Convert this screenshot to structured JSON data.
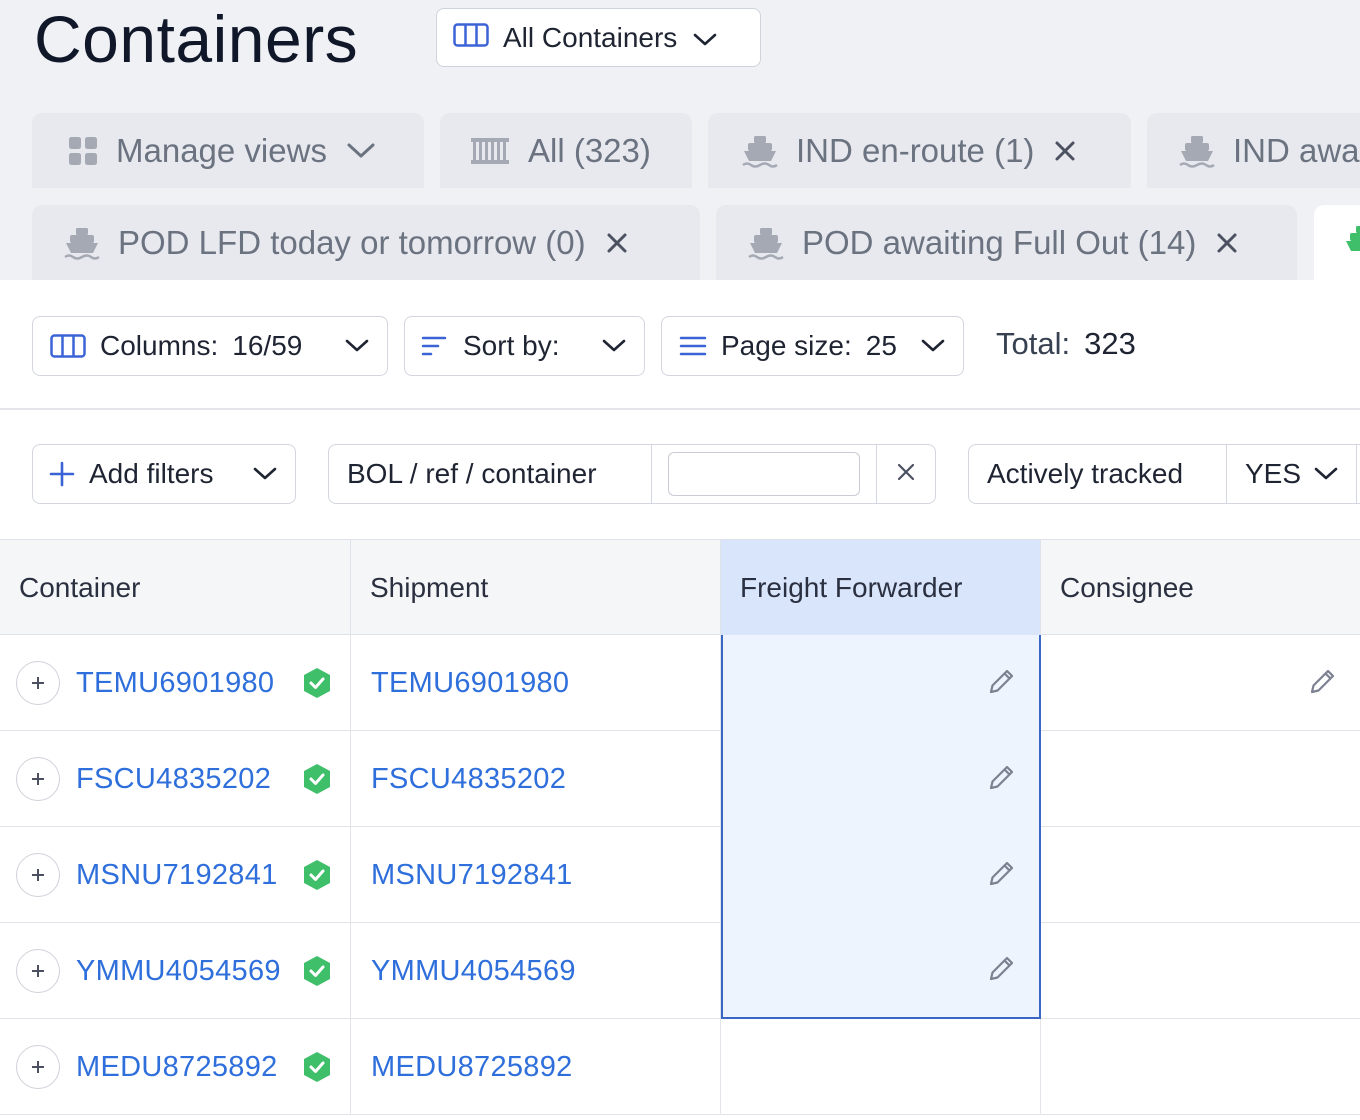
{
  "header": {
    "title": "Containers",
    "view_select": {
      "label": "All Containers",
      "icon": "columns-icon"
    }
  },
  "tabs": [
    {
      "label": "Manage views",
      "icon": "grid-icon",
      "closable": false,
      "dropdown": true
    },
    {
      "label": "All (323)",
      "icon": "container-icon",
      "closable": false
    },
    {
      "label": "IND en-route (1)",
      "icon": "ship-icon",
      "closable": true
    },
    {
      "label": "IND awa",
      "icon": "ship-icon",
      "closable": false
    },
    {
      "label": "POD LFD today or tomorrow (0)",
      "icon": "ship-icon",
      "closable": true
    },
    {
      "label": "POD awaiting Full Out (14)",
      "icon": "ship-icon",
      "closable": true
    },
    {
      "label": "",
      "icon": "ship-icon-green",
      "active": true
    }
  ],
  "toolbar": {
    "columns_label": "Columns:",
    "columns_value": "16/59",
    "sort_label": "Sort by:",
    "page_size_label": "Page size:",
    "page_size_value": "25",
    "total_label": "Total:",
    "total_value": "323"
  },
  "filters": {
    "add_filters_label": "Add filters",
    "search_label": "BOL / ref / container",
    "search_value": "",
    "tracked_label": "Actively tracked",
    "tracked_value": "YES"
  },
  "table": {
    "columns": [
      "Container",
      "Shipment",
      "Freight Forwarder",
      "Consignee"
    ],
    "rows": [
      {
        "container": "TEMU6901980",
        "shipment": "TEMU6901980",
        "verified": true
      },
      {
        "container": "FSCU4835202",
        "shipment": "FSCU4835202",
        "verified": true
      },
      {
        "container": "MSNU7192841",
        "shipment": "MSNU7192841",
        "verified": true
      },
      {
        "container": "YMMU4054569",
        "shipment": "YMMU4054569",
        "verified": true
      },
      {
        "container": "MEDU8725892",
        "shipment": "MEDU8725892",
        "verified": true
      }
    ]
  },
  "colors": {
    "link": "#2f6fdb",
    "accent_blue": "#3b63d6",
    "verified_green": "#3fbf6a",
    "selected_column_bg": "#d9e5fb",
    "header_bg": "#f0f1f5"
  }
}
